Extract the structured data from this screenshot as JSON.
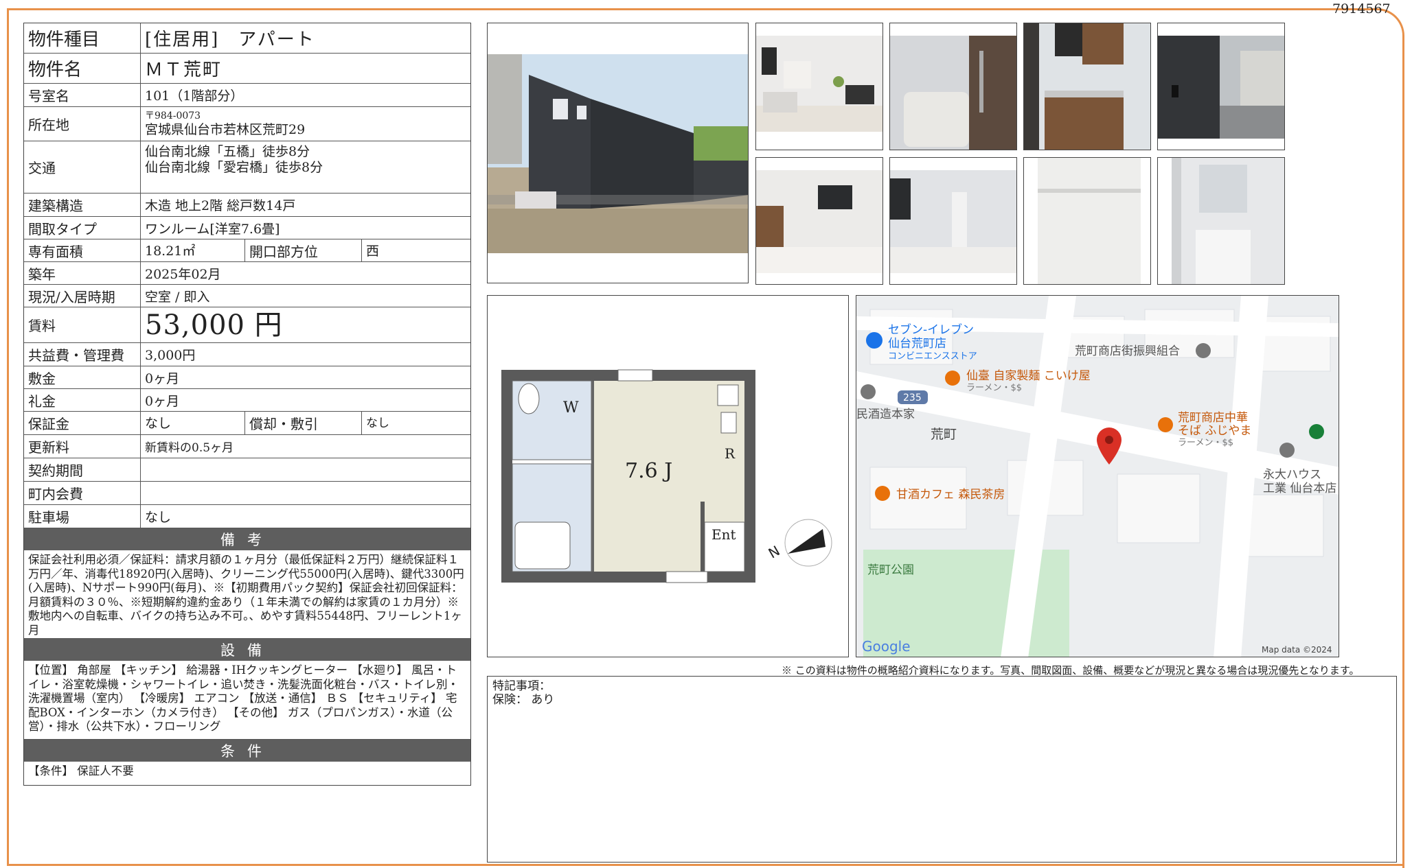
{
  "doc_id": "7914567",
  "info": {
    "type_label": "物件種目",
    "type_value": "[住居用]　アパート",
    "name_label": "物件名",
    "name_value": "ＭＴ荒町",
    "room_label": "号室名",
    "room_value": "101（1階部分）",
    "address_label": "所在地",
    "postal": "〒984-0073",
    "address_value": "宮城県仙台市若林区荒町29",
    "access_label": "交通",
    "access_1": "仙台南北線「五橋」徒歩8分",
    "access_2": "仙台南北線「愛宕橋」徒歩8分",
    "structure_label": "建築構造",
    "structure_value": "木造  地上2階  総戸数14戸",
    "layout_label": "間取タイプ",
    "layout_value": "ワンルーム[洋室7.6畳]",
    "area_label": "専有面積",
    "area_value": "18.21㎡",
    "direction_label": "開口部方位",
    "direction_value": "西",
    "built_label": "築年",
    "built_value": "2025年02月",
    "status_label": "現況/入居時期",
    "status_value": "空室 /  即入",
    "rent_label": "賃料",
    "rent_value": "53,000 円",
    "fee_label": "共益費・管理費",
    "fee_value": "3,000円",
    "deposit_label": "敷金",
    "deposit_value": "0ヶ月",
    "key_label": "礼金",
    "key_value": "0ヶ月",
    "guarantee_label": "保証金",
    "guarantee_value": "なし",
    "amort_label": "償却・敷引",
    "amort_value": "なし",
    "renewal_label": "更新料",
    "renewal_value": "新賃料の0.5ヶ月",
    "contract_label": "契約期間",
    "contract_value": "",
    "community_label": "町内会費",
    "community_value": "",
    "parking_label": "駐車場",
    "parking_value": "なし"
  },
  "remarks": {
    "head": "備考",
    "text": "保証会社利用必須／保証料：請求月額の１ヶ月分（最低保証料２万円）継続保証料１万円／年、消毒代18920円(入居時)、クリーニング代55000円(入居時)、鍵代3300円(入居時)、Nサポート990円(毎月)、※【初期費用パック契約】保証会社初回保証料：月額賃料の３０％、※短期解約違約金あり（１年未満での解約は家賃の１カ月分）※敷地内への自転車、バイクの持ち込み不可。、めやす賃料55448円、フリーレント1ヶ月"
  },
  "equipment": {
    "head": "設備",
    "text": "【位置】 角部屋 【キッチン】 給湯器・IHクッキングヒーター 【水廻り】 風呂・トイレ・浴室乾燥機・シャワートイレ・追い焚き・洗髪洗面化粧台・バス・トイレ別・洗濯機置場（室内） 【冷暖房】 エアコン 【放送・通信】 ＢＳ 【セキュリティ】 宅配BOX・インターホン（カメラ付き） 【その他】 ガス（プロパンガス）・水道（公営）・排水（公共下水）・フローリング"
  },
  "conditions": {
    "head": "条件",
    "text": "【条件】 保証人不要"
  },
  "floorplan": {
    "room_size": "7.6 J",
    "w": "W",
    "r": "R",
    "ent": "Ent",
    "north": "N"
  },
  "map": {
    "place_1": "セブン-イレブン",
    "place_1b": "仙台荒町店",
    "place_1c": "コンビニエンスストア",
    "place_2": "荒町商店街振興組合",
    "place_3": "仙臺 自家製麺 こいけ屋",
    "place_3b": "ラーメン・$$",
    "route": "235",
    "place_4": "民酒造本家",
    "place_5": "荒町",
    "place_6": "荒町商店中華",
    "place_6b": "そば ふじやま",
    "place_6c": "ラーメン・$$",
    "place_7": "永大ハウス",
    "place_7b": "工業 仙台本店",
    "place_8": "甘酒カフェ 森民茶房",
    "place_9": "荒町公園",
    "google": "Google",
    "mapdata": "Map data ©2024"
  },
  "note": "※ この資料は物件の概略紹介資料になります。写真、間取図面、設備、概要などが現況と異なる場合は現況優先となります。",
  "special": {
    "title": "特記事項：",
    "insurance": "保険：  あり"
  }
}
